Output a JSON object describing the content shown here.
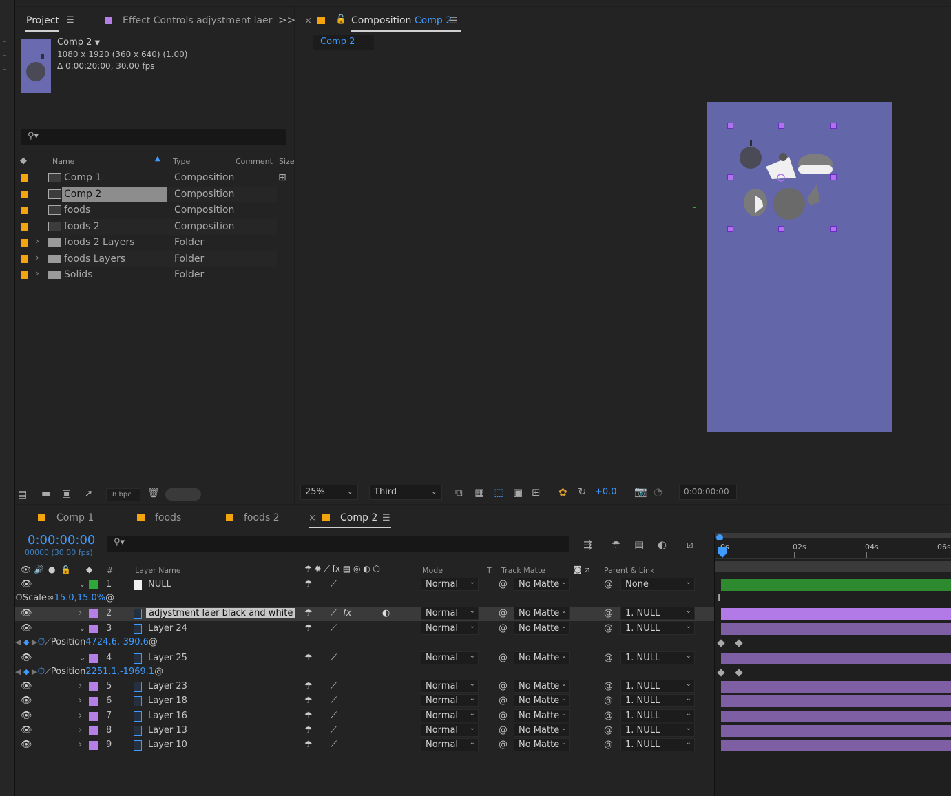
{
  "project_panel": {
    "tabs": [
      {
        "label": "Project",
        "active": true
      },
      {
        "label": "Effect Controls adjystment laer",
        "active": false
      }
    ],
    "overflow_icon": ">>",
    "preview": {
      "name": "Comp 2",
      "dimensions": "1080 x 1920  (360 x 640) (1.00)",
      "duration": "Δ 0:00:20:00, 30.00 fps"
    },
    "search": {
      "placeholder": ""
    },
    "columns": {
      "name": "Name",
      "type": "Type",
      "comment": "Comment",
      "size": "Size"
    },
    "items": [
      {
        "name": "Comp 1",
        "type": "Composition",
        "kind": "comp",
        "selected": false
      },
      {
        "name": "Comp 2",
        "type": "Composition",
        "kind": "comp",
        "selected": true
      },
      {
        "name": "foods",
        "type": "Composition",
        "kind": "comp",
        "selected": false
      },
      {
        "name": "foods 2",
        "type": "Composition",
        "kind": "comp",
        "selected": false
      },
      {
        "name": "foods 2 Layers",
        "type": "Folder",
        "kind": "folder",
        "selected": false
      },
      {
        "name": "foods Layers",
        "type": "Folder",
        "kind": "folder",
        "selected": false
      },
      {
        "name": "Solids",
        "type": "Folder",
        "kind": "folder",
        "selected": false
      }
    ],
    "bit_depth": "8 bpc"
  },
  "composition_panel": {
    "tab_prefix": "Composition",
    "tab_comp": "Comp 2",
    "breadcrumb": "Comp 2",
    "zoom": "25%",
    "view_layout": "Third",
    "exposure": "+0.0",
    "timecode": "0:00:00:00"
  },
  "timeline": {
    "tabs": [
      {
        "label": "Comp 1",
        "active": false
      },
      {
        "label": "foods",
        "active": false
      },
      {
        "label": "foods 2",
        "active": false
      },
      {
        "label": "Comp 2",
        "active": true
      }
    ],
    "current_time": "0:00:00:00",
    "frame_readout": "00000 (30.00 fps)",
    "columns": {
      "hash": "#",
      "layer_name": "Layer Name",
      "mode": "Mode",
      "t": "T",
      "track_matte": "Track Matte",
      "parent": "Parent & Link"
    },
    "layers": [
      {
        "num": "1",
        "name": "NULL",
        "color": "#2fa83a",
        "mode": "Normal",
        "matte": "No Matte",
        "parent": "None",
        "expanded": true,
        "null": true
      },
      {
        "prop": "Scale",
        "value": "15.0,15.0%"
      },
      {
        "num": "2",
        "name": "adjystment laer black and white",
        "color": "#b67fe6",
        "mode": "Normal",
        "matte": "No Matte",
        "parent": "1. NULL",
        "expanded": false,
        "selected": true
      },
      {
        "num": "3",
        "name": "Layer 24",
        "color": "#b67fe6",
        "mode": "Normal",
        "matte": "No Matte",
        "parent": "1. NULL",
        "expanded": true
      },
      {
        "prop": "Position",
        "value": "4724.6,-390.6"
      },
      {
        "num": "4",
        "name": "Layer 25",
        "color": "#b67fe6",
        "mode": "Normal",
        "matte": "No Matte",
        "parent": "1. NULL",
        "expanded": true
      },
      {
        "prop": "Position",
        "value": "2251.1,-1969.1"
      },
      {
        "num": "5",
        "name": "Layer 23",
        "color": "#b67fe6",
        "mode": "Normal",
        "matte": "No Matte",
        "parent": "1. NULL",
        "expanded": false
      },
      {
        "num": "6",
        "name": "Layer 18",
        "color": "#b67fe6",
        "mode": "Normal",
        "matte": "No Matte",
        "parent": "1. NULL",
        "expanded": false
      },
      {
        "num": "7",
        "name": "Layer 16",
        "color": "#b67fe6",
        "mode": "Normal",
        "matte": "No Matte",
        "parent": "1. NULL",
        "expanded": false
      },
      {
        "num": "8",
        "name": "Layer 13",
        "color": "#b67fe6",
        "mode": "Normal",
        "matte": "No Matte",
        "parent": "1. NULL",
        "expanded": false
      },
      {
        "num": "9",
        "name": "Layer 10",
        "color": "#b67fe6",
        "mode": "Normal",
        "matte": "No Matte",
        "parent": "1. NULL",
        "expanded": false
      }
    ],
    "ruler": [
      "0s",
      "02s",
      "04s",
      "06s"
    ]
  },
  "colors": {
    "accent_blue": "#3e9bff",
    "label_orange": "#f4a40e",
    "label_purple": "#b67fe6",
    "label_green": "#2fa83a",
    "comp_bg": "#6366a8"
  }
}
